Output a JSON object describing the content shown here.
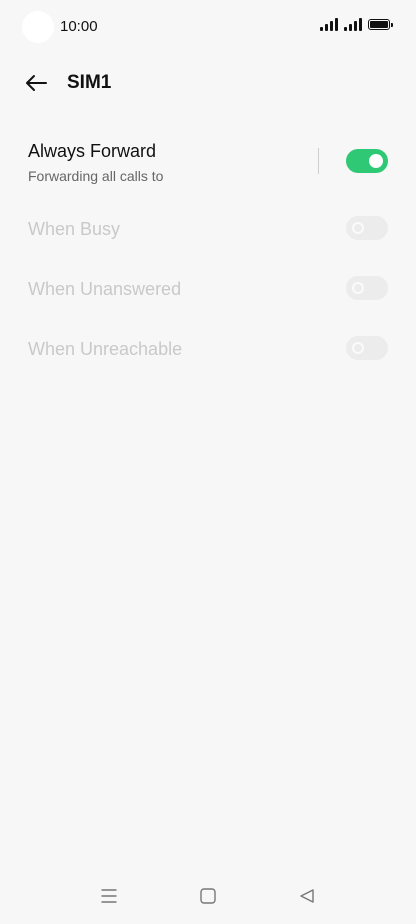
{
  "status_bar": {
    "time": "10:00",
    "icons": [
      "signal-sim1-icon",
      "signal-sim2-icon",
      "battery-icon"
    ]
  },
  "header": {
    "title": "SIM1",
    "back_icon": "back-arrow-icon"
  },
  "settings": [
    {
      "id": "always-forward",
      "label": "Always Forward",
      "sublabel": "Forwarding all calls to",
      "enabled": true,
      "toggle_on": true
    },
    {
      "id": "when-busy",
      "label": "When Busy",
      "enabled": false,
      "toggle_on": false
    },
    {
      "id": "when-unanswered",
      "label": "When Unanswered",
      "enabled": false,
      "toggle_on": false
    },
    {
      "id": "when-unreachable",
      "label": "When Unreachable",
      "enabled": false,
      "toggle_on": false
    }
  ],
  "nav_bar": {
    "buttons": [
      "menu-icon",
      "home-icon",
      "back-triangle-icon"
    ]
  },
  "colors": {
    "background": "#f7f7f7",
    "toggle_on": "#2fc976",
    "toggle_off": "#ececec",
    "disabled_text": "#c9c9c9"
  }
}
